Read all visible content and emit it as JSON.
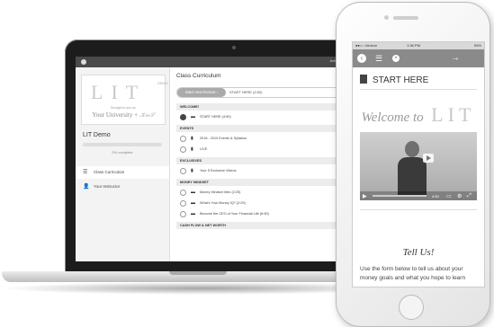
{
  "laptop": {
    "topbar": {
      "admin_label": "Admin"
    },
    "logo": {
      "wordmark": "LIT",
      "demo_tag": "DEMO",
      "brought_by": "Brought to you by",
      "university": "Your University + "
    },
    "sidebar": {
      "course_title": "LIT Demo",
      "progress_percent": 0,
      "progress_label": "0% complete",
      "items": [
        {
          "label": "Class Curriculum",
          "icon": "list-icon",
          "active": true
        },
        {
          "label": "Your Instructor",
          "icon": "user-icon",
          "active": false
        }
      ]
    },
    "main": {
      "title": "Class Curriculum",
      "start_button": "Start next lecture  ›",
      "start_next": "START HERE (4:50)",
      "sections": [
        {
          "title": "WELCOME!",
          "lectures": [
            {
              "title": "START HERE (4:50)",
              "type": "video-icon",
              "done": true
            }
          ]
        },
        {
          "title": "EVENTS",
          "lectures": [
            {
              "title": "2018 - 2019 Events & Syllabus",
              "type": "doc-icon",
              "done": false
            },
            {
              "title": "LIVE",
              "type": "doc-icon",
              "done": false
            }
          ]
        },
        {
          "title": "EXCLUSIVES",
          "lectures": [
            {
              "title": "Your 5 Exclusive Videos",
              "type": "doc-icon",
              "done": false
            }
          ]
        },
        {
          "title": "MONEY MINDSET",
          "lectures": [
            {
              "title": "Money Mindset Intro (2:25)",
              "type": "video-icon",
              "done": false
            },
            {
              "title": "What's Your Money IQ? (2:29)",
              "type": "video-icon",
              "done": false
            },
            {
              "title": "Become the CEO of Your Financial Life (6:50)",
              "type": "video-icon",
              "done": false
            }
          ]
        },
        {
          "title": "CASH FLOW & NET WORTH",
          "lectures": []
        }
      ]
    }
  },
  "phone": {
    "status": {
      "carrier": "●●○○ Verizon",
      "time": "1:36 PM",
      "battery": "59%"
    },
    "nav": {
      "back": "‹",
      "list": "☰",
      "close": "×",
      "next": "→"
    },
    "heading": "START HERE",
    "welcome_script": "Welcome to",
    "welcome_word": "LIT",
    "video_time": "4:50",
    "tell_us": "Tell Us!",
    "body_text": "Use the form below to tell us about your money goals and what you hope to learn"
  }
}
